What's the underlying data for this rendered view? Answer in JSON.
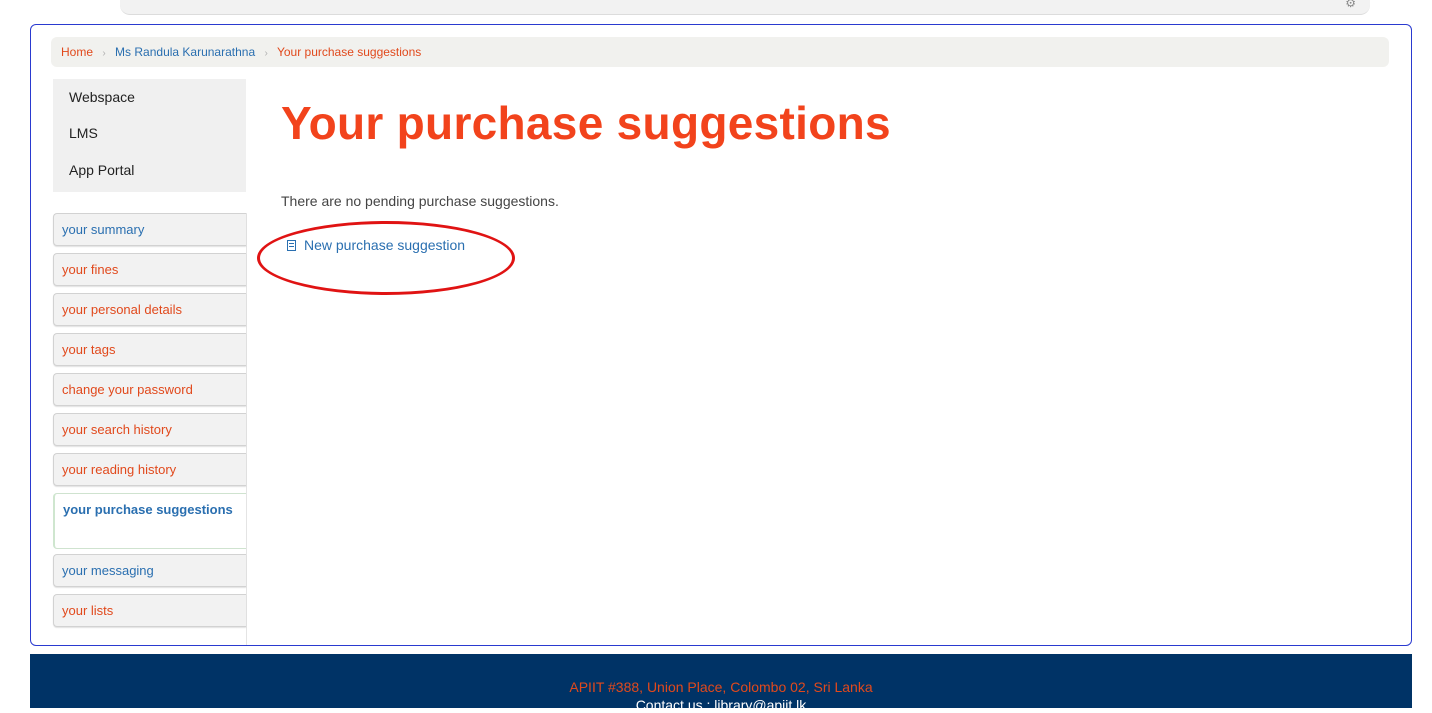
{
  "breadcrumb": {
    "home": "Home",
    "user": "Ms Randula Karunarathna",
    "current": "Your purchase suggestions",
    "separator": "›"
  },
  "external_links": [
    "Webspace",
    "LMS",
    "App Portal"
  ],
  "nav": {
    "items": [
      {
        "label": "your summary",
        "color": "blue"
      },
      {
        "label": "your fines",
        "color": "orange"
      },
      {
        "label": "your personal details",
        "color": "orange"
      },
      {
        "label": "your tags",
        "color": "orange"
      },
      {
        "label": "change your password",
        "color": "orange"
      },
      {
        "label": "your search history",
        "color": "orange"
      },
      {
        "label": "your reading history",
        "color": "orange"
      },
      {
        "label": "your purchase suggestions",
        "color": "blue",
        "active": true
      },
      {
        "label": "your messaging",
        "color": "blue"
      },
      {
        "label": "your lists",
        "color": "orange"
      }
    ]
  },
  "main": {
    "title": "Your purchase suggestions",
    "message": "There are no pending purchase suggestions.",
    "new_link": "New purchase suggestion"
  },
  "footer": {
    "address": "APIIT #388, Union Place, Colombo 02, Sri Lanka",
    "contact": "Contact us : library@apiit.lk"
  },
  "colors": {
    "accent_orange": "#f2431c",
    "link_blue": "#2a6fb0",
    "footer_bg": "#003366",
    "annotation_red": "#e01313"
  }
}
